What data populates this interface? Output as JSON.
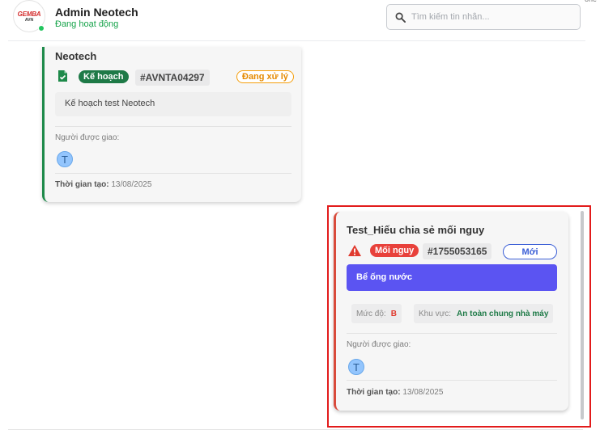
{
  "header": {
    "logo_main": "GEMBA",
    "logo_sub": "AVN",
    "user_name": "Admin Neotech",
    "user_status": "Đang hoạt động",
    "search_placeholder": "Tìm kiếm tin nhắn...",
    "edge_text": "one",
    "online_color": "#22c55e"
  },
  "messages": [
    {
      "title": "Neotech",
      "type_label": "Kế hoạch",
      "id": "#AVNTA04297",
      "status": "Đang xử lý",
      "description": "Kế hoạch test Neotech",
      "assignee_label": "Người được giao:",
      "assignee_initial": "T",
      "created_label": "Thời gian tạo:",
      "created_date": "13/08/2025",
      "accent_color": "#1e8a4a",
      "icon": "document-check-icon"
    },
    {
      "title": "Test_Hiếu chia sẻ mối nguy",
      "type_label": "Mối nguy",
      "id": "#1755053165",
      "status": "Mới",
      "description": "Bể ống nước",
      "level_label": "Mức độ:",
      "level_value": "B",
      "area_label": "Khu vực:",
      "area_value": "An toàn chung nhà máy",
      "assignee_label": "Người được giao:",
      "assignee_initial": "T",
      "created_label": "Thời gian tạo:",
      "created_date": "13/08/2025",
      "accent_color": "#d94b3c",
      "icon": "warning-triangle-icon"
    }
  ]
}
